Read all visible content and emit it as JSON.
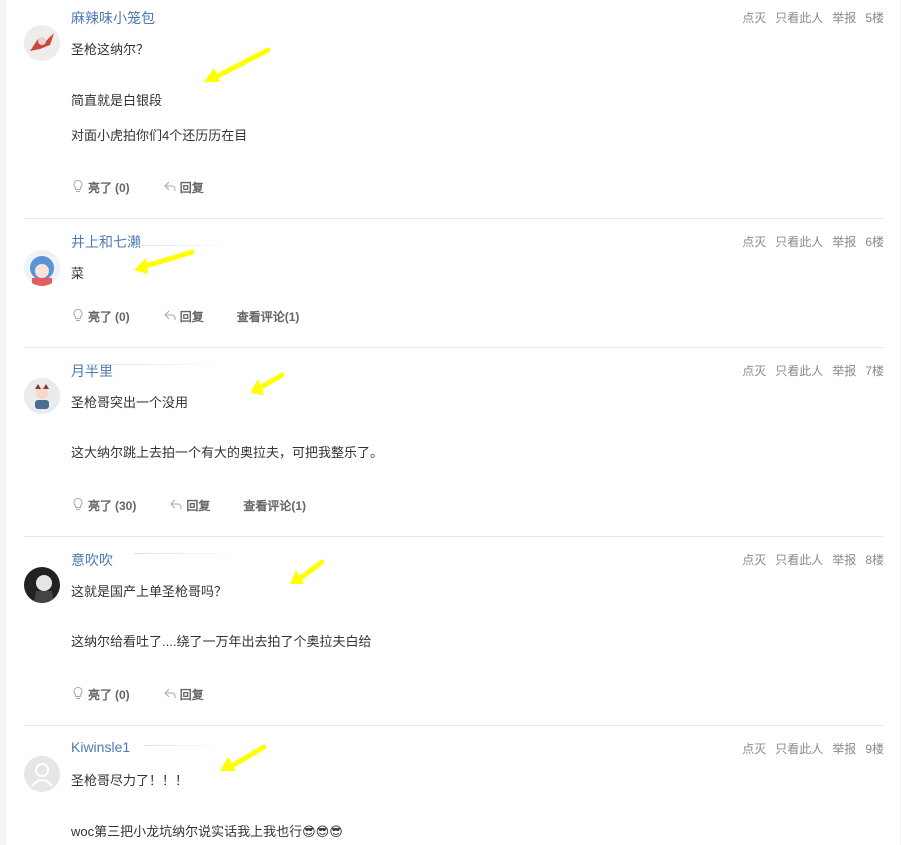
{
  "labels": {
    "like_prefix": "亮了",
    "reply": "回复",
    "action_light": "点灭",
    "action_only": "只看此人",
    "action_report": "举报"
  },
  "posts": [
    {
      "username": "麻辣味小笼包",
      "floor": "5楼",
      "paragraphs": [
        "圣枪这纳尔？",
        "简直就是白银段",
        "对面小虎拍你们4个还历历在目"
      ],
      "likes": "(0)",
      "comments": ""
    },
    {
      "username": "井上和七濑",
      "floor": "6楼",
      "paragraphs": [
        "菜"
      ],
      "likes": "(0)",
      "comments": "查看评论(1)"
    },
    {
      "username": "月半里",
      "floor": "7楼",
      "paragraphs": [
        "圣枪哥突出一个没用",
        "这大纳尔跳上去拍一个有大的奥拉夫，可把我整乐了。"
      ],
      "likes": "(30)",
      "comments": "查看评论(1)"
    },
    {
      "username": "意吹吹",
      "floor": "8楼",
      "paragraphs": [
        "这就是国产上单圣枪哥吗？",
        "这纳尔给看吐了....绕了一万年出去拍了个奥拉夫白给"
      ],
      "likes": "(0)",
      "comments": ""
    },
    {
      "username": "Kiwinsle1",
      "floor": "9楼",
      "paragraphs": [
        "圣枪哥尽力了！！！",
        "woc第三把小龙坑纳尔说实话我上我也行😎😎😎"
      ],
      "likes": "",
      "comments": ""
    }
  ],
  "colors": {
    "username": "#4d7ab3",
    "arrow": "#ffff00",
    "meta": "#8a8a8a"
  },
  "icons": [
    "bulb-icon",
    "reply-arrow-icon",
    "avatar-default-icon"
  ]
}
